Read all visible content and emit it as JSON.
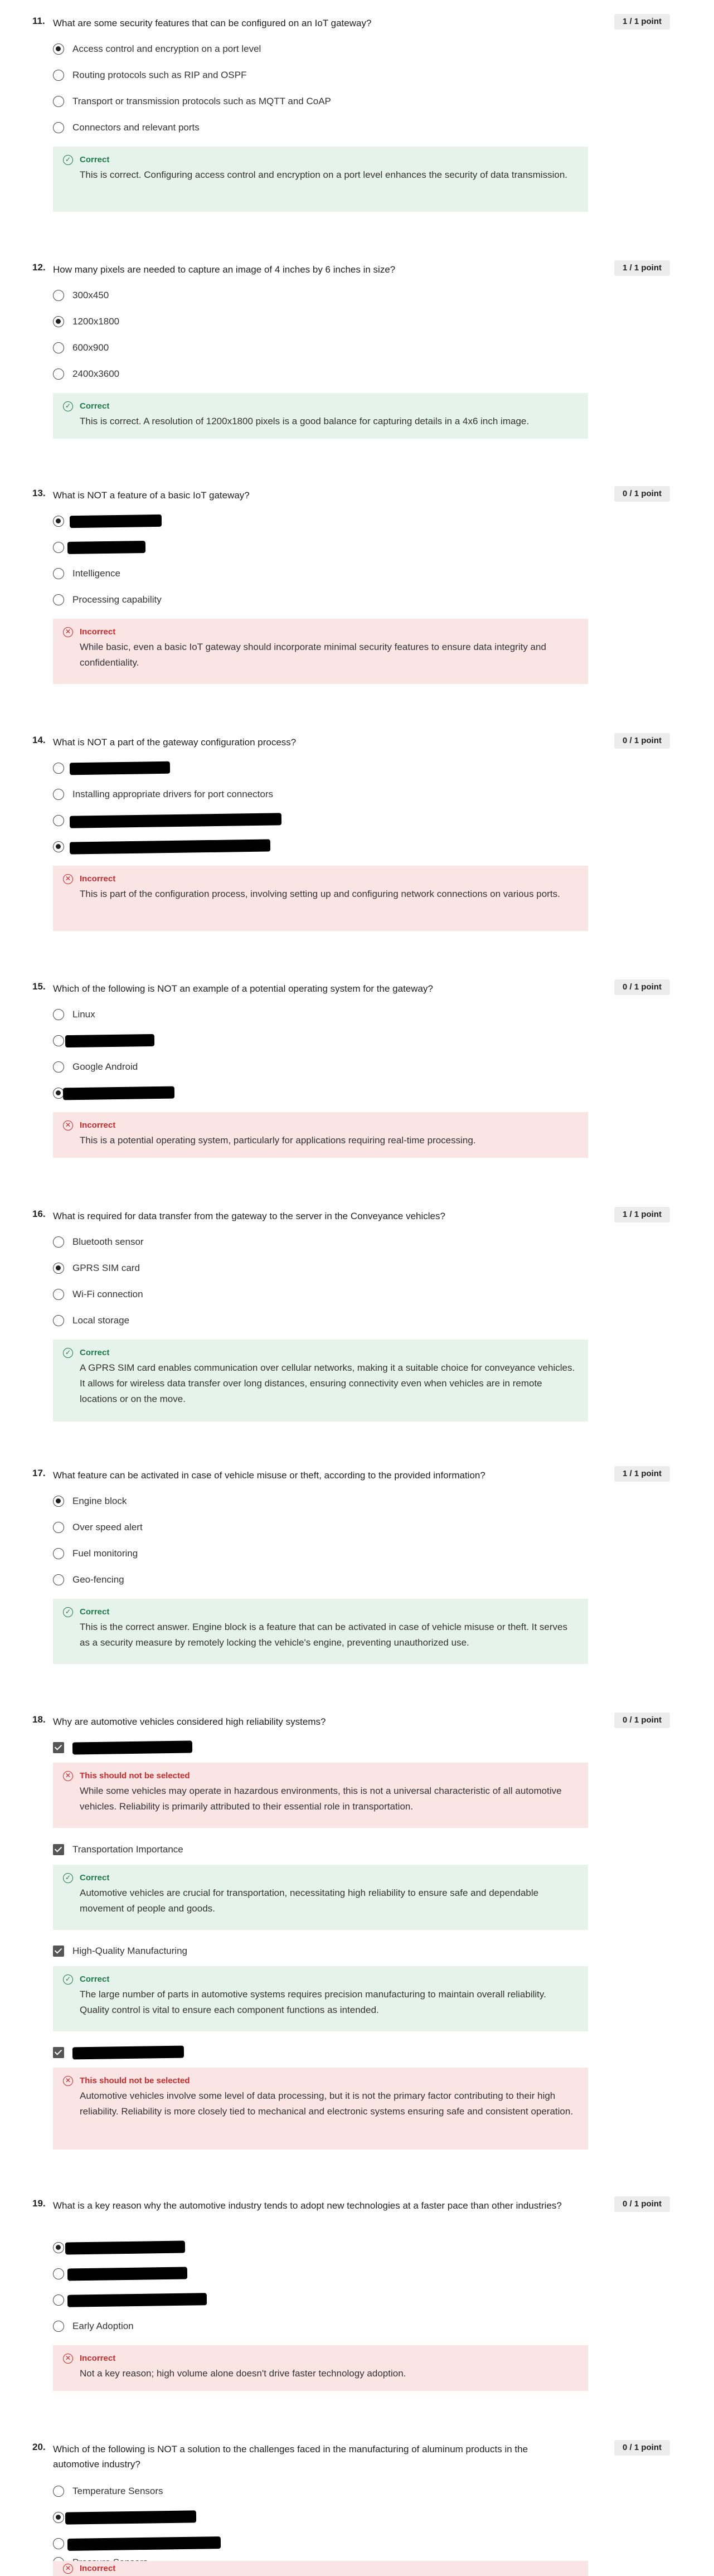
{
  "questions": [
    {
      "number": "11.",
      "text": "What are some security features that can be configured on an IoT gateway?",
      "score": "1 / 1 point",
      "input": "radio",
      "options": [
        {
          "label": "Access control and encryption on a port level",
          "selected": true
        },
        {
          "label": "Routing protocols such as RIP and OSPF",
          "selected": false
        },
        {
          "label": "Transport or transmission protocols such as MQTT and CoAP",
          "selected": false
        },
        {
          "label": "Connectors and relevant ports",
          "selected": false
        }
      ],
      "feedback": [
        {
          "status": "correct",
          "title": "Correct",
          "text": "This is correct. Configuring access control and encryption on a port level enhances the security of data transmission."
        }
      ]
    },
    {
      "number": "12.",
      "text": "How many pixels are needed to capture an image of 4 inches by 6 inches in size?",
      "score": "1 / 1 point",
      "input": "radio",
      "options": [
        {
          "label": "300x450",
          "selected": false
        },
        {
          "label": "1200x1800",
          "selected": true
        },
        {
          "label": "600x900",
          "selected": false
        },
        {
          "label": "2400x3600",
          "selected": false
        }
      ],
      "feedback": [
        {
          "status": "correct",
          "title": "Correct",
          "text": "This is correct. A resolution of 1200x1800 pixels is a good balance for capturing details in a 4x6 inch image."
        }
      ]
    },
    {
      "number": "13.",
      "text": "What is NOT a feature of a basic IoT gateway?",
      "score": "0 / 1 point",
      "input": "radio",
      "options": [
        {
          "label": "",
          "selected": true
        },
        {
          "label": "",
          "selected": false
        },
        {
          "label": "Intelligence",
          "selected": false
        },
        {
          "label": "Processing capability",
          "selected": false
        }
      ],
      "feedback": [
        {
          "status": "incorrect",
          "title": "Incorrect",
          "text": "While basic, even a basic IoT gateway should incorporate minimal security features to ensure data integrity and confidentiality."
        }
      ]
    },
    {
      "number": "14.",
      "text": "What is NOT a part of the gateway configuration process?",
      "score": "0 / 1 point",
      "input": "radio",
      "options": [
        {
          "label": "",
          "selected": false
        },
        {
          "label": "Installing appropriate drivers for port connectors",
          "selected": false
        },
        {
          "label": "",
          "selected": false
        },
        {
          "label": "",
          "selected": true
        }
      ],
      "feedback": [
        {
          "status": "incorrect",
          "title": "Incorrect",
          "text": "This is part of the configuration process, involving setting up and configuring network connections on various ports."
        }
      ]
    },
    {
      "number": "15.",
      "text": "Which of the following is NOT an example of a potential operating system for the gateway?",
      "score": "0 / 1 point",
      "input": "radio",
      "options": [
        {
          "label": "Linux",
          "selected": false
        },
        {
          "label": "",
          "selected": false
        },
        {
          "label": "Google Android",
          "selected": false
        },
        {
          "label": "",
          "selected": true
        }
      ],
      "feedback": [
        {
          "status": "incorrect",
          "title": "Incorrect",
          "text": "This is a potential operating system, particularly for applications requiring real-time processing."
        }
      ]
    },
    {
      "number": "16.",
      "text": "What is required for data transfer from the gateway to the server in the Conveyance vehicles?",
      "score": "1 / 1 point",
      "input": "radio",
      "options": [
        {
          "label": "Bluetooth sensor",
          "selected": false
        },
        {
          "label": "GPRS SIM card",
          "selected": true
        },
        {
          "label": "Wi-Fi connection",
          "selected": false
        },
        {
          "label": "Local storage",
          "selected": false
        }
      ],
      "feedback": [
        {
          "status": "correct",
          "title": "Correct",
          "text": "A GPRS SIM card enables communication over cellular networks, making it a suitable choice for conveyance vehicles. It allows for wireless data transfer over long distances, ensuring connectivity even when vehicles are in remote locations or on the move."
        }
      ]
    },
    {
      "number": "17.",
      "text": "What feature can be activated in case of vehicle misuse or theft, according to the provided information?",
      "score": "1 / 1 point",
      "input": "radio",
      "options": [
        {
          "label": "Engine block",
          "selected": true
        },
        {
          "label": "Over speed alert",
          "selected": false
        },
        {
          "label": "Fuel monitoring",
          "selected": false
        },
        {
          "label": "Geo-fencing",
          "selected": false
        }
      ],
      "feedback": [
        {
          "status": "correct",
          "title": "Correct",
          "text": "This is the correct answer. Engine block is a feature that can be activated in case of vehicle misuse or theft. It serves as a security measure by remotely locking the vehicle's engine, preventing unauthorized use."
        }
      ]
    },
    {
      "number": "18.",
      "text": "Why are automotive vehicles considered high reliability systems?",
      "score": "0 / 1 point",
      "input": "checkbox",
      "options": [
        {
          "label": "",
          "selected": true
        },
        {
          "label": "Transportation Importance",
          "selected": true
        },
        {
          "label": "High-Quality Manufacturing",
          "selected": true
        },
        {
          "label": "",
          "selected": true
        }
      ],
      "feedback": [
        {
          "status": "incorrect",
          "title": "This should not be selected",
          "text": "While some vehicles may operate in hazardous environments, this is not a universal characteristic of all automotive vehicles. Reliability is primarily attributed to their essential role in transportation."
        },
        {
          "status": "correct",
          "title": "Correct",
          "text": "Automotive vehicles are crucial for transportation, necessitating high reliability to ensure safe and dependable movement of people and goods."
        },
        {
          "status": "correct",
          "title": "Correct",
          "text": "The large number of parts in automotive systems requires precision manufacturing to maintain overall reliability. Quality control is vital to ensure each component functions as intended."
        },
        {
          "status": "incorrect",
          "title": "This should not be selected",
          "text": "Automotive vehicles involve some level of data processing, but it is not the primary factor contributing to their high reliability. Reliability is more closely tied to mechanical and electronic systems ensuring safe and consistent operation."
        }
      ]
    },
    {
      "number": "19.",
      "text": "What is a key reason why the automotive industry tends to adopt new technologies at a faster pace than other industries?",
      "score": "0 / 1 point",
      "input": "radio",
      "options": [
        {
          "label": "",
          "selected": true
        },
        {
          "label": "",
          "selected": false
        },
        {
          "label": "",
          "selected": false
        },
        {
          "label": "Early Adoption",
          "selected": false
        }
      ],
      "feedback": [
        {
          "status": "incorrect",
          "title": "Incorrect",
          "text": "Not a key reason; high volume alone doesn't drive faster technology adoption."
        }
      ]
    },
    {
      "number": "20.",
      "text": "Which of the following is NOT a solution to the challenges faced in the manufacturing of aluminum products in the automotive industry?",
      "score": "0 / 1 point",
      "input": "radio",
      "options": [
        {
          "label": "Temperature Sensors",
          "selected": false
        },
        {
          "label": "",
          "selected": true
        },
        {
          "label": "",
          "selected": false
        },
        {
          "label": "Pressure Sensors",
          "selected": false
        }
      ],
      "feedback": [
        {
          "status": "incorrect",
          "title": "Incorrect",
          "text": ""
        }
      ]
    }
  ],
  "colors": {
    "correct_bg": "#e6f2ec",
    "correct_text": "#1d7a4a",
    "incorrect_bg": "#fbe4e4",
    "incorrect_text": "#c82b2b",
    "score_badge_bg": "#ececec"
  },
  "icons": {
    "correct": "check-circle-icon",
    "incorrect": "x-circle-icon",
    "radio": "radio-button",
    "checkbox": "checkbox-checked"
  }
}
